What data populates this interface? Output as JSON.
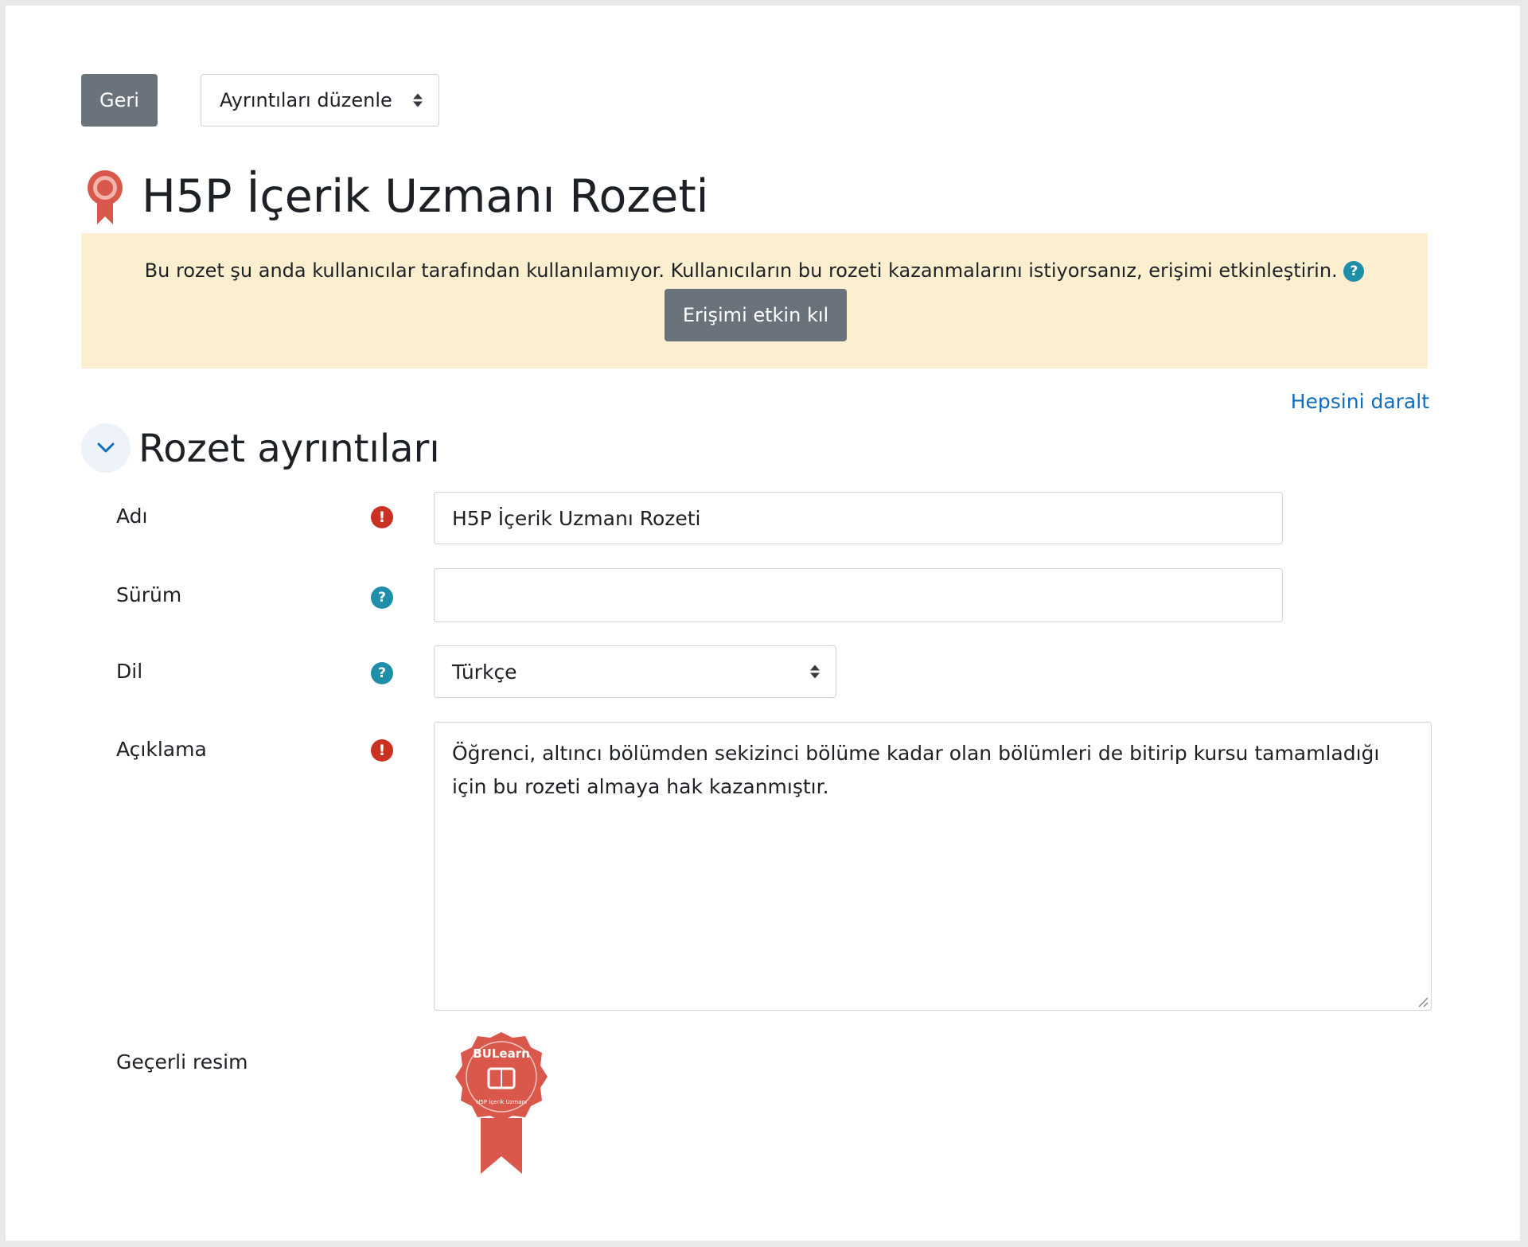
{
  "toolbar": {
    "back_label": "Geri",
    "action_select_value": "Ayrıntıları düzenle"
  },
  "page": {
    "title": "H5P İçerik Uzmanı Rozeti",
    "title_icon": "badge-ribbon-icon"
  },
  "alert": {
    "message": "Bu rozet şu anda kullanıcılar tarafından kullanılamıyor. Kullanıcıların bu rozeti kazanmalarını istiyorsanız, erişimi etkinleştirin.",
    "button_label": "Erişimi etkin kıl",
    "background": "#fcefd0"
  },
  "collapse_all_label": "Hepsini daralt",
  "section": {
    "title": "Rozet ayrıntıları",
    "expanded": true
  },
  "form": {
    "name": {
      "label": "Adı",
      "value": "H5P İçerik Uzmanı Rozeti",
      "required": true
    },
    "version": {
      "label": "Sürüm",
      "value": ""
    },
    "language": {
      "label": "Dil",
      "value": "Türkçe"
    },
    "description": {
      "label": "Açıklama",
      "value": "Öğrenci, altıncı bölümden sekizinci bölüme kadar olan bölümleri de bitirip kursu tamamladığı için bu rozeti almaya hak kazanmıştır.",
      "required": true
    },
    "current_image": {
      "label": "Geçerli resim",
      "badge_text": "BULearn",
      "badge_subtext": "H5P İçerik Uzmanı"
    }
  },
  "colors": {
    "button_secondary": "#6a737b",
    "link": "#0f6cbf",
    "required": "#ca3120",
    "help": "#1f8ea8",
    "badge": "#d9574b"
  }
}
